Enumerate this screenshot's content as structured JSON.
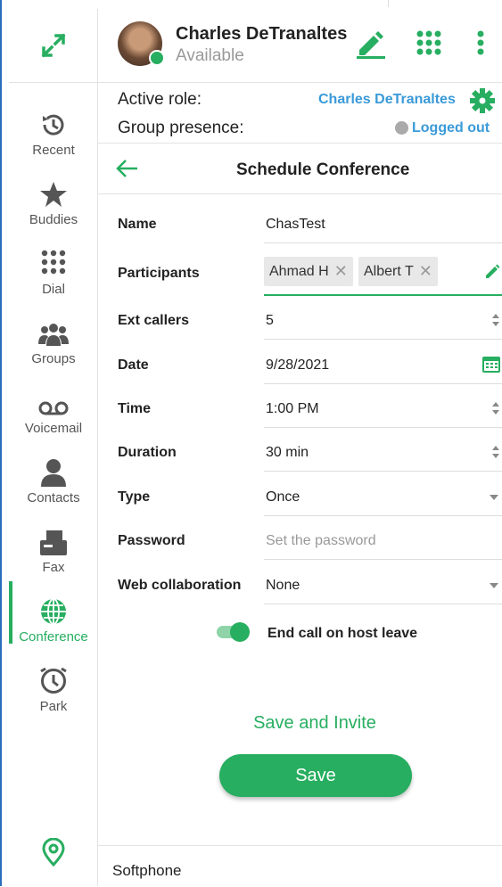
{
  "user": {
    "name": "Charles DeTranaltes",
    "status": "Available"
  },
  "roles": {
    "active_role_label": "Active role:",
    "active_role_value": "Charles DeTranaltes",
    "group_presence_label": "Group presence:",
    "group_presence_value": "Logged out"
  },
  "sidebar": {
    "items": [
      {
        "label": "Recent",
        "icon": "history-icon"
      },
      {
        "label": "Buddies",
        "icon": "star-icon"
      },
      {
        "label": "Dial",
        "icon": "dialpad-icon"
      },
      {
        "label": "Groups",
        "icon": "groups-icon"
      },
      {
        "label": "Voicemail",
        "icon": "voicemail-icon"
      },
      {
        "label": "Contacts",
        "icon": "contact-icon"
      },
      {
        "label": "Fax",
        "icon": "fax-icon"
      },
      {
        "label": "Conference",
        "icon": "globe-icon"
      },
      {
        "label": "Park",
        "icon": "clock-icon"
      }
    ],
    "active": "Conference"
  },
  "page": {
    "title": "Schedule Conference"
  },
  "form": {
    "name": {
      "label": "Name",
      "value": "ChasTest"
    },
    "participants": {
      "label": "Participants",
      "chips": [
        "Ahmad H",
        "Albert T"
      ]
    },
    "ext_callers": {
      "label": "Ext callers",
      "value": "5"
    },
    "date": {
      "label": "Date",
      "value": "9/28/2021"
    },
    "time": {
      "label": "Time",
      "value": "1:00 PM"
    },
    "duration": {
      "label": "Duration",
      "value": "30 min"
    },
    "type": {
      "label": "Type",
      "value": "Once"
    },
    "password": {
      "label": "Password",
      "placeholder": "Set the password"
    },
    "web_collab": {
      "label": "Web collaboration",
      "value": "None"
    },
    "end_call_toggle": {
      "label": "End call on host leave",
      "on": true
    }
  },
  "actions": {
    "save_invite": "Save and Invite",
    "save": "Save"
  },
  "footer": {
    "label": "Softphone"
  },
  "colors": {
    "accent": "#27ae60",
    "link": "#3a9ad9"
  }
}
